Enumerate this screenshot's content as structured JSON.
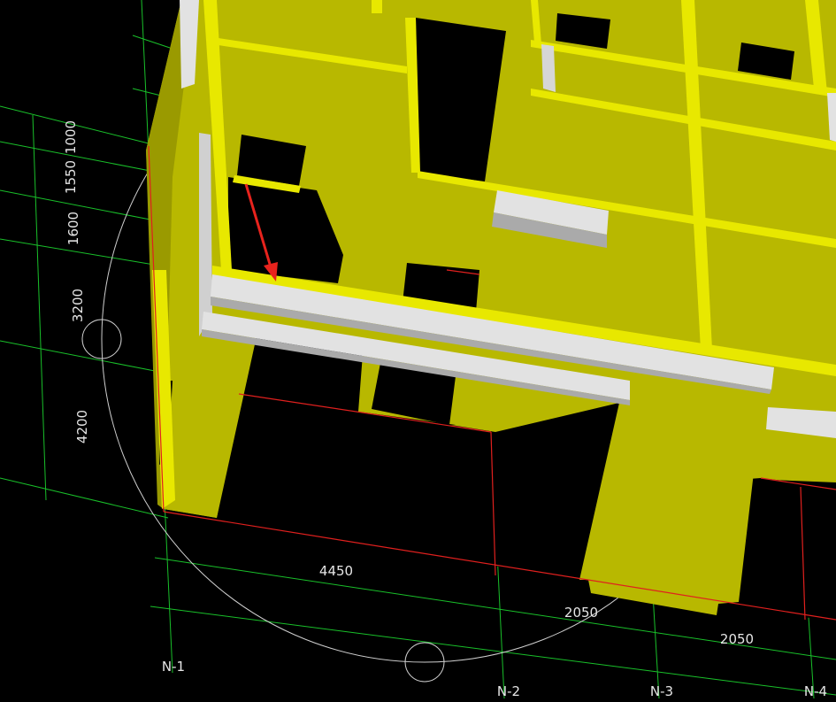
{
  "app": {
    "view_type": "3D structural model viewport"
  },
  "colors": {
    "background": "#000000",
    "grid_line": "#19c02a",
    "red_line": "#e0201e",
    "wall_fill": "#b8b800",
    "wall_highlight": "#e8e800",
    "beam_white": "#e2e2e2",
    "beam_gray": "#aaaaaa",
    "dimension_text": "#e6e6e6",
    "orbit_circle": "#cfcfcf",
    "pointer_arrow": "#e8231d"
  },
  "dimensions": {
    "left": [
      "1000",
      "1550",
      "1600",
      "3200",
      "4200"
    ],
    "bottom": [
      "4450",
      "2050",
      "2050"
    ]
  },
  "axis_labels": [
    "N-1",
    "N-2",
    "N-3",
    "N-4"
  ],
  "icons": {
    "orbit": "orbit-circle-icon",
    "arrow": "red-arrow-icon"
  }
}
